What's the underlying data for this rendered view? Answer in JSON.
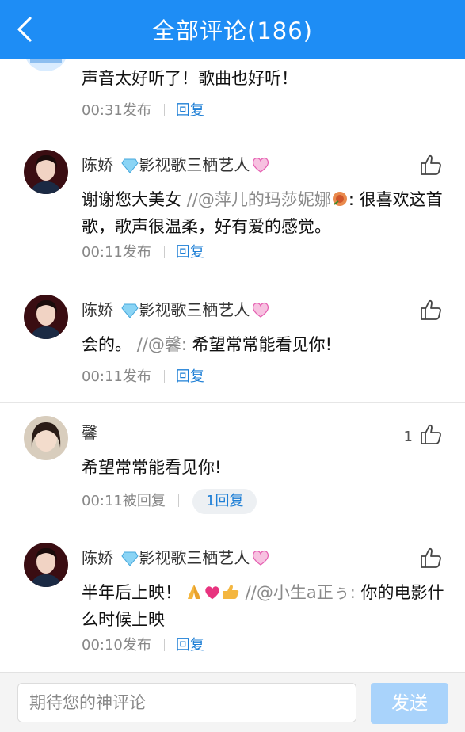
{
  "header": {
    "title": "全部评论(186)"
  },
  "comments": [
    {
      "name": "",
      "text": "声音太好听了！歌曲也好听！",
      "quote": "",
      "time": "00:31发布",
      "reply": "回复"
    },
    {
      "name": "陈娇",
      "tag": "影视歌三栖艺人",
      "text": "谢谢您大美女 ",
      "quote": "//@萍儿的玛莎妮娜",
      "text_after": ": 很喜欢这首歌，歌声很温柔，好有爱的感觉。",
      "time": "00:11发布",
      "reply": "回复"
    },
    {
      "name": "陈娇",
      "tag": "影视歌三栖艺人",
      "text": "会的。 ",
      "quote": "//@馨:",
      "text_after": " 希望常常能看见你!",
      "time": "00:11发布",
      "reply": "回复"
    },
    {
      "name": "馨",
      "like_count": "1",
      "text": "希望常常能看见你!",
      "time": "00:11被回复",
      "reply_pill": "1回复"
    },
    {
      "name": "陈娇",
      "tag": "影视歌三栖艺人",
      "text": "半年后上映！",
      "quote": " //@小生a正ぅ:",
      "text_after": " 你的电影什么时候上映",
      "time": "00:10发布",
      "reply": "回复"
    }
  ],
  "footer": {
    "placeholder": "期待您的神评论",
    "send_label": "发送"
  },
  "colors": {
    "header": "#1e8df5",
    "link": "#1e7fd6",
    "send_disabled": "#a9d3fb"
  }
}
